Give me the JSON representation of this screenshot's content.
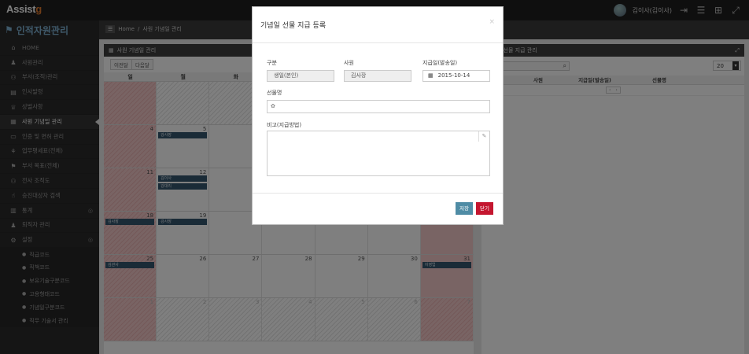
{
  "header": {
    "logo_main": "Assist",
    "logo_accent": "g",
    "user_name": "김이사(김이사)",
    "icons": [
      "avatar",
      "logout-icon",
      "menu-icon",
      "grid-icon",
      "fullscreen-icon"
    ]
  },
  "sidebar": {
    "title": "인적자원관리",
    "items": [
      {
        "label": "HOME",
        "icon": "home-icon"
      },
      {
        "label": "사원관리",
        "icon": "user-icon"
      },
      {
        "label": "부서(조직)관리",
        "icon": "sitemap-icon"
      },
      {
        "label": "인사발령",
        "icon": "list-icon"
      },
      {
        "label": "상벌사항",
        "icon": "trophy-icon"
      },
      {
        "label": "사원 기념일 관리",
        "icon": "calendar-icon",
        "active": true
      },
      {
        "label": "인증 및 면허 관리",
        "icon": "card-icon"
      },
      {
        "label": "업무평세표(전체)",
        "icon": "chart-icon"
      },
      {
        "label": "부서 목표(전체)",
        "icon": "flag-icon"
      },
      {
        "label": "전사 조직도",
        "icon": "sitemap-icon"
      },
      {
        "label": "승진대상자 검색",
        "icon": "thumbs-up-icon"
      },
      {
        "label": "통계",
        "icon": "bar-chart-icon",
        "caret": "◎"
      },
      {
        "label": "퇴직자 관리",
        "icon": "user-icon"
      },
      {
        "label": "설정",
        "icon": "cogs-icon",
        "caret": "◎"
      }
    ],
    "subitems": [
      "직급코드",
      "직책코드",
      "보유기술구분코드",
      "고용형태코드",
      "기념일구분코드",
      "직무 기술서 관리"
    ]
  },
  "breadcrumb": {
    "home": "Home",
    "sep": "/",
    "current": "사원 기념일 관리"
  },
  "calendar_panel": {
    "title": "사원 기념일 관리",
    "prev": "이전달",
    "next": "다음달",
    "weekdays": [
      "일",
      "월",
      "화",
      "수",
      "목",
      "금",
      "토"
    ],
    "weeks": [
      [
        {
          "n": ""
        },
        {
          "n": ""
        },
        {
          "n": ""
        },
        {
          "n": ""
        },
        {
          "n": ""
        },
        {
          "n": ""
        },
        {
          "n": ""
        }
      ],
      [
        {
          "n": "4"
        },
        {
          "n": "5",
          "evt": [
            "강사장"
          ]
        },
        {
          "n": ""
        },
        {
          "n": ""
        },
        {
          "n": ""
        },
        {
          "n": ""
        },
        {
          "n": ""
        }
      ],
      [
        {
          "n": "11"
        },
        {
          "n": "12",
          "evt": [
            "김이사",
            "강대리"
          ]
        },
        {
          "n": ""
        },
        {
          "n": ""
        },
        {
          "n": ""
        },
        {
          "n": ""
        },
        {
          "n": ""
        }
      ],
      [
        {
          "n": "18",
          "evt": [
            "김사장"
          ]
        },
        {
          "n": "19",
          "evt": [
            "강사장"
          ]
        },
        {
          "n": ""
        },
        {
          "n": "",
          "evt": [
            "김경영"
          ]
        },
        {
          "n": ""
        },
        {
          "n": ""
        },
        {
          "n": ""
        }
      ],
      [
        {
          "n": "25",
          "evt": [
            "김관사"
          ]
        },
        {
          "n": "26"
        },
        {
          "n": "27"
        },
        {
          "n": "28"
        },
        {
          "n": "29"
        },
        {
          "n": "30"
        },
        {
          "n": "31",
          "evt": [
            "이영업"
          ]
        }
      ],
      [
        {
          "n": "1"
        },
        {
          "n": "2"
        },
        {
          "n": "3"
        },
        {
          "n": "4"
        },
        {
          "n": "5"
        },
        {
          "n": "6"
        },
        {
          "n": "7"
        }
      ]
    ]
  },
  "list_panel": {
    "title": "기념일 선물 지급 관리",
    "page_size": "20",
    "columns": [
      "사원",
      "지급일(발송일)",
      "선물명"
    ],
    "count": "0",
    "pager": [
      "‹",
      "›"
    ]
  },
  "modal": {
    "title": "기념일 선물 지급 등록",
    "close": "×",
    "type_label": "구분",
    "type_value": "생일(본인)",
    "employee_label": "사원",
    "employee_value": "김사장",
    "date_label": "지급일(발송일)",
    "date_value": "2015-10-14",
    "gift_label": "선물명",
    "gift_value": "",
    "note_label": "비고(지급방법)",
    "save": "저장",
    "cancel": "닫기"
  }
}
